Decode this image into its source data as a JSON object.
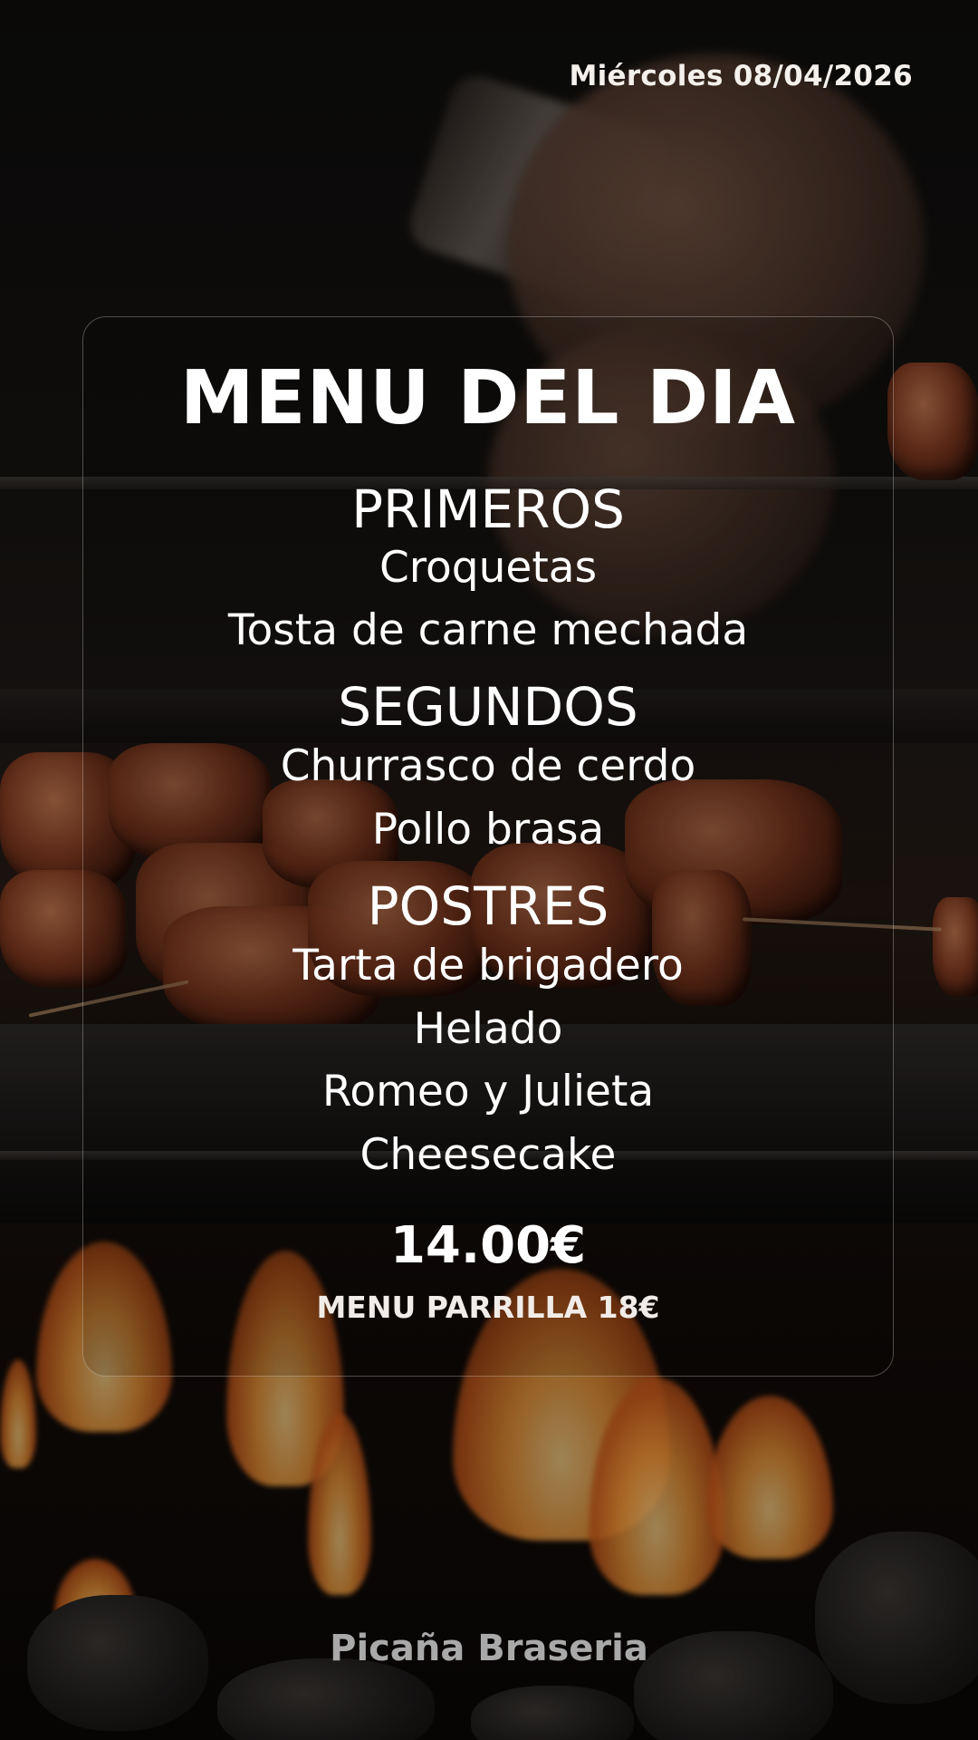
{
  "date": "Miércoles 08/04/2026",
  "menu": {
    "title": "MENU DEL DIA",
    "sections": [
      {
        "heading": "PRIMEROS",
        "items": [
          "Croquetas",
          "Tosta de carne mechada"
        ]
      },
      {
        "heading": "SEGUNDOS",
        "items": [
          "Churrasco de cerdo",
          "Pollo brasa"
        ]
      },
      {
        "heading": "POSTRES",
        "items": [
          "Tarta de brigadero",
          "Helado",
          "Romeo y Julieta",
          "Cheesecake"
        ]
      }
    ],
    "price": "14.00€",
    "alt_menu": "MENU PARRILLA 18€"
  },
  "brand": "Picaña Braseria",
  "colors": {
    "text": "#ffffff",
    "brand_text": "#a9a9a9",
    "card_border": "rgba(255,255,255,0.28)"
  }
}
